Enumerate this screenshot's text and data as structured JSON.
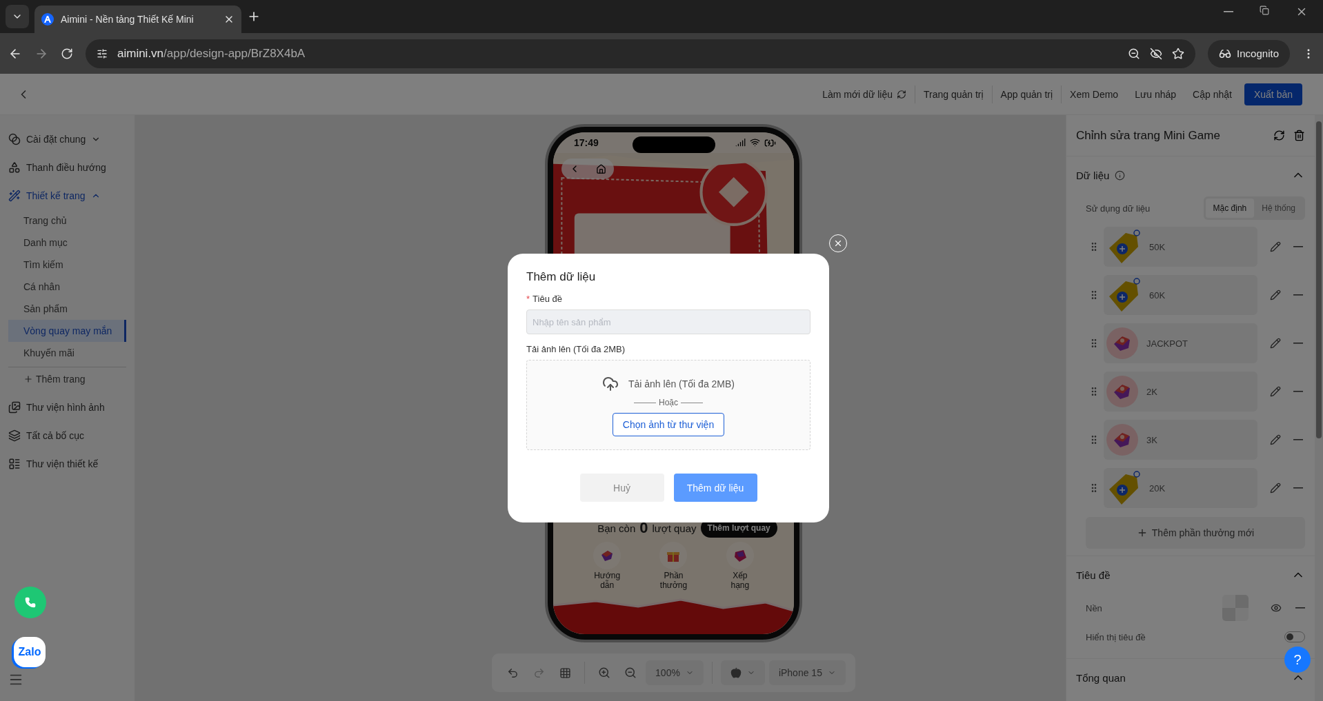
{
  "browser": {
    "tab_title": "Aimini - Nền tảng Thiết Kế Mini",
    "url_host": "aimini.vn",
    "url_path": "/app/design-app/BrZ8X4bA",
    "profile": "Incognito"
  },
  "header": {
    "actions": [
      {
        "label": "Làm mới dữ liệu",
        "kind": "refresh"
      },
      {
        "label": "Trang quản trị",
        "kind": "link"
      },
      {
        "label": "App quản trị",
        "kind": "link"
      },
      {
        "label": "Xem Demo",
        "kind": "plain"
      },
      {
        "label": "Lưu nháp",
        "kind": "plain"
      },
      {
        "label": "Cập nhật",
        "kind": "plain"
      },
      {
        "label": "Xuất bản",
        "kind": "primary"
      }
    ]
  },
  "sidebar": {
    "items": [
      {
        "label": "Cài đặt chung",
        "selected": false,
        "expanded": false
      },
      {
        "label": "Thanh điều hướng",
        "selected": false
      },
      {
        "label": "Thiết kế trang",
        "selected": true,
        "expanded": true,
        "children": [
          {
            "label": "Trang chủ",
            "selected": false
          },
          {
            "label": "Danh mục",
            "selected": false
          },
          {
            "label": "Tìm kiếm",
            "selected": false
          },
          {
            "label": "Cá nhân",
            "selected": false
          },
          {
            "label": "Sản phẩm",
            "selected": false
          },
          {
            "label": "Vòng quay may mắn",
            "selected": true
          },
          {
            "label": "Khuyến mãi",
            "selected": false
          }
        ],
        "add_label": "Thêm trang"
      },
      {
        "label": "Thư viện hình ảnh",
        "selected": false
      },
      {
        "label": "Tất cả bố cục",
        "selected": false
      },
      {
        "label": "Thư viện thiết kế",
        "selected": false
      }
    ]
  },
  "phone": {
    "time": "17:49",
    "spins_before": "Bạn còn",
    "spins": "0",
    "spins_after": "lượt quay",
    "add_spins": "Thêm lượt quay",
    "shortcuts": [
      {
        "label": "Hướng dẫn",
        "kind": "guide"
      },
      {
        "label": "Phần thưởng",
        "kind": "gift"
      },
      {
        "label": "Xếp hạng",
        "kind": "rank"
      }
    ]
  },
  "toolbar": {
    "zoom": "100%",
    "device": "iPhone 15"
  },
  "panel": {
    "title": "Chỉnh sửa trang Mini Game",
    "data": {
      "title": "Dữ liệu",
      "expanded": true,
      "source_label": "Sử dụng dữ liệu",
      "sources": [
        {
          "label": "Mặc định",
          "selected": true
        },
        {
          "label": "Hệ thống",
          "selected": false
        }
      ],
      "rewards": [
        {
          "label": "50K",
          "kind": "tag"
        },
        {
          "label": "60K",
          "kind": "tag"
        },
        {
          "label": "JACKPOT",
          "kind": "gift"
        },
        {
          "label": "2K",
          "kind": "gift"
        },
        {
          "label": "3K",
          "kind": "gift"
        },
        {
          "label": "20K",
          "kind": "tag"
        }
      ],
      "add_label": "Thêm phần thưởng mới"
    },
    "heading": {
      "title": "Tiêu đề",
      "expanded": true,
      "background_label": "Nền",
      "show_label": "Hiển thị tiêu đề",
      "show_on": false
    },
    "overview": {
      "title": "Tổng quan",
      "expanded": true
    }
  },
  "modal": {
    "title": "Thêm dữ liệu",
    "required_mark": "*",
    "name_label": "Tiêu đề",
    "name_placeholder": "Nhập tên sản phẩm",
    "upload_label": "Tải ảnh lên (Tối đa 2MB)",
    "drop_text": "Tải ảnh lên (Tối đa 2MB)",
    "or_text": "Hoặc",
    "library_button": "Chọn ảnh từ thư viện",
    "cancel": "Huỷ",
    "submit": "Thêm dữ liệu"
  },
  "floating": {
    "zalo": "Zalo",
    "help": "?"
  }
}
